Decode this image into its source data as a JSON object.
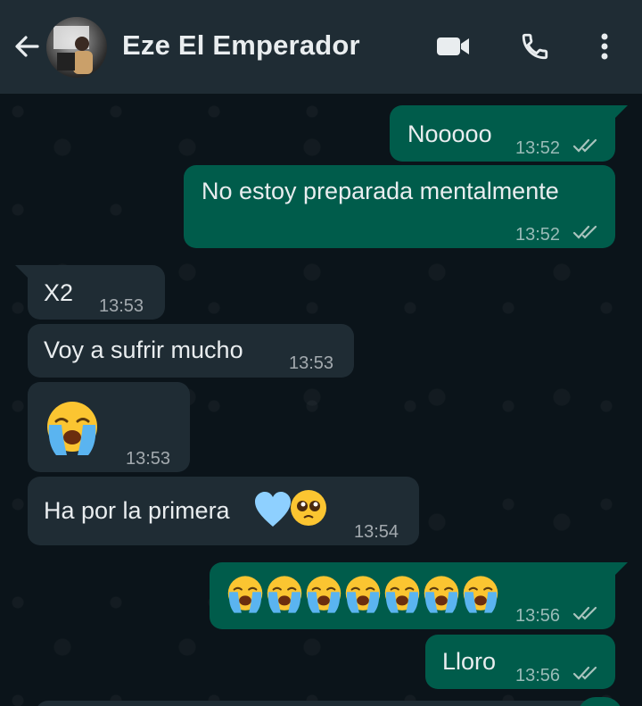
{
  "header": {
    "contact_name": "Eze El Emperador",
    "back_icon": "arrow-left-icon",
    "video_icon": "video-camera-icon",
    "call_icon": "phone-icon",
    "menu_icon": "more-vertical-icon"
  },
  "colors": {
    "header_bg": "#1f2c34",
    "chat_bg": "#0b141a",
    "outgoing_bubble": "#005c4b",
    "incoming_bubble": "#1f2c34",
    "read_ticks": "#a9c3bd"
  },
  "messages": [
    {
      "direction": "outgoing",
      "text": "Nooooo",
      "time": "13:52",
      "status": "read"
    },
    {
      "direction": "outgoing",
      "text": "No estoy preparada mentalmente",
      "time": "13:52",
      "status": "read"
    },
    {
      "direction": "incoming",
      "text": "X2",
      "time": "13:53"
    },
    {
      "direction": "incoming",
      "text": "Voy a sufrir mucho",
      "time": "13:53"
    },
    {
      "direction": "incoming",
      "text": "",
      "emoji": "loudly-crying-face",
      "time": "13:53"
    },
    {
      "direction": "incoming",
      "text": "Ha por la primera",
      "emoji": "light-blue-heart, pleading-face",
      "time": "13:54"
    },
    {
      "direction": "outgoing",
      "text": "",
      "emoji": "loudly-crying-face x7",
      "time": "13:56",
      "status": "read"
    },
    {
      "direction": "outgoing",
      "text": "Lloro",
      "time": "13:56",
      "status": "read"
    }
  ]
}
